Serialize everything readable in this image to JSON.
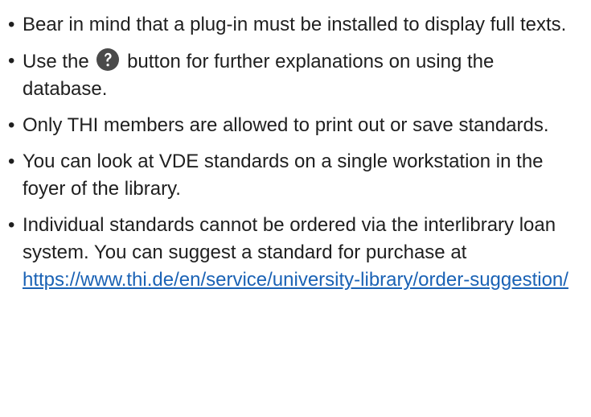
{
  "bullet_symbol": "•",
  "items": [
    {
      "text": "Bear in mind that a plug-in must be installed to display full texts."
    },
    {
      "text_before": "Use the",
      "icon": "question-circle-icon",
      "text_after": "button for further explanations on using the database."
    },
    {
      "text": "Only THI members are allowed to print out or save standards."
    },
    {
      "text": "You can look at VDE standards on a single workstation in the foyer of the library."
    },
    {
      "text": "Individual standards cannot be ordered via the interlibrary loan system. You can suggest a standard for purchase at",
      "link_text": "https://www.thi.de/en/service/university-library/order-suggestion/"
    }
  ],
  "colors": {
    "text": "#1f1f1f",
    "link": "#1a62b5",
    "icon_bg": "#4a4a4a"
  }
}
